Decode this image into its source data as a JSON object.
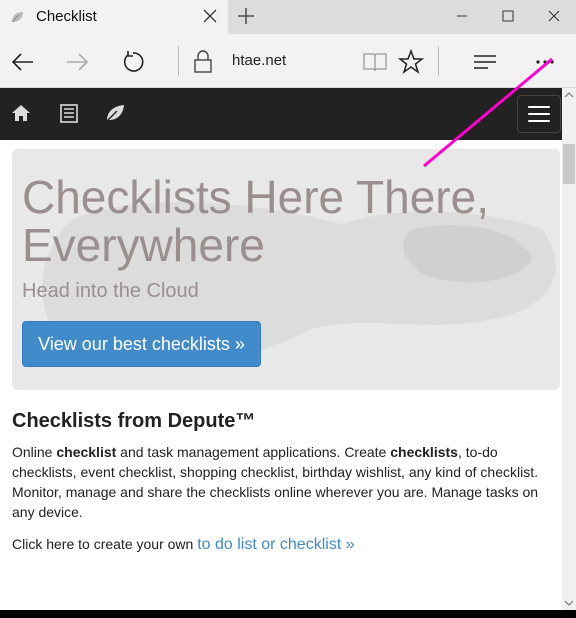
{
  "browser": {
    "tab_title": "Checklist",
    "url": "htae.net"
  },
  "jumbotron": {
    "title": "Checklists Here There, Everywhere",
    "subtitle": "Head into the Cloud",
    "cta": "View our best checklists »"
  },
  "content": {
    "heading": "Checklists from Depute™",
    "para_parts": [
      "Online ",
      "checklist",
      " and task management applications. Create ",
      "checklists",
      ", to-do checklists, event checklist, shopping checklist, birthday wishlist, any kind of checklist. Monitor, manage and share the checklists online wherever you are. Manage tasks on any device."
    ],
    "click_prefix": "Click here to create your own ",
    "click_link": "to do list or checklist »"
  },
  "colors": {
    "navbar": "#222222",
    "cta": "#428bca",
    "title": "#9a8e8e",
    "annotation": "#ff00cc"
  },
  "icons": {
    "nav": [
      "home-icon",
      "list-icon",
      "leaf-icon"
    ]
  }
}
